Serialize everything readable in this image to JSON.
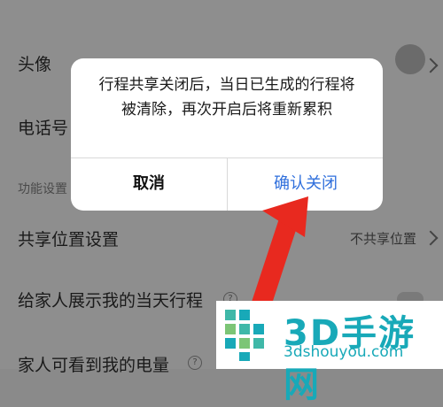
{
  "settings": {
    "avatar_label": "头像",
    "phone_label": "电话号",
    "section_label": "功能设置",
    "share_location_label": "共享位置设置",
    "share_location_value": "不共享位置",
    "show_trip_label": "给家人展示我的当天行程",
    "battery_label": "家人可看到我的电量"
  },
  "dialog": {
    "message": "行程共享关闭后，当日已生成的行程将被清除，再次开启后将重新累积",
    "cancel_label": "取消",
    "confirm_label": "确认关闭"
  },
  "watermark": {
    "title": "3D手游网",
    "url": "3dshouyou.com"
  },
  "colors": {
    "accent": "#2f6fdc",
    "arrow": "#e8291f",
    "watermark": "#18a9b8"
  }
}
